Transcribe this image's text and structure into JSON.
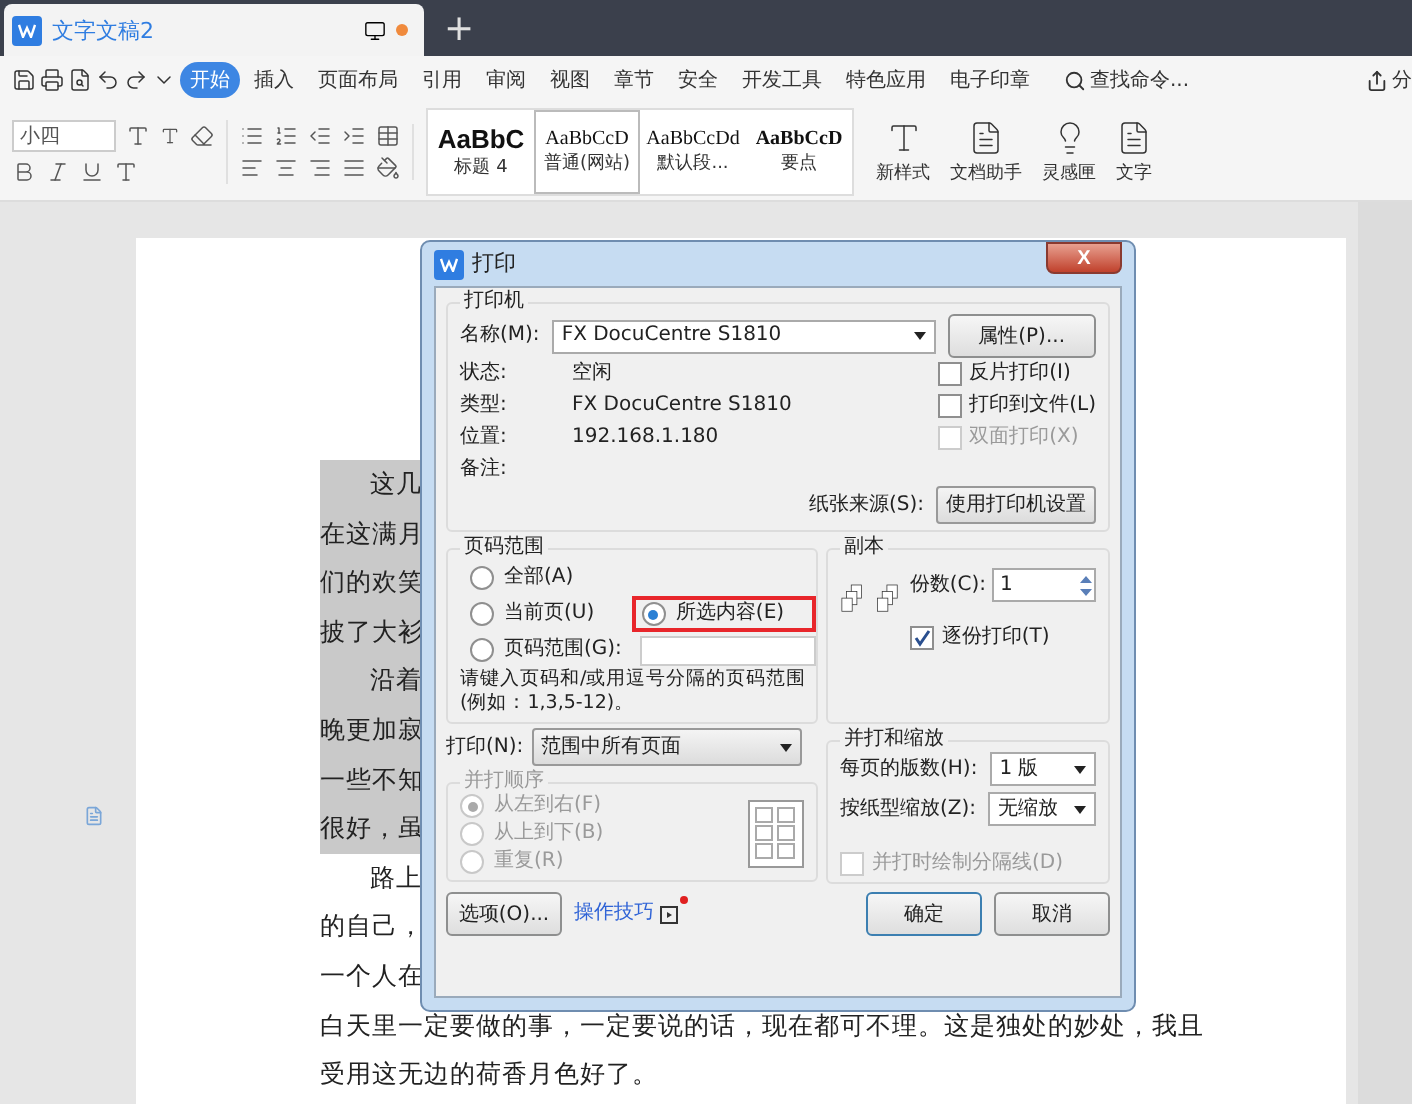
{
  "app_tab": {
    "title": "文字文稿2",
    "unsaved": true
  },
  "new_tab": "+",
  "menu": [
    {
      "label": "开始",
      "selected": true
    },
    {
      "label": "插入",
      "selected": false
    },
    {
      "label": "页面布局",
      "selected": false
    },
    {
      "label": "引用",
      "selected": false
    },
    {
      "label": "审阅",
      "selected": false
    },
    {
      "label": "视图",
      "selected": false
    },
    {
      "label": "章节",
      "selected": false
    },
    {
      "label": "安全",
      "selected": false
    },
    {
      "label": "开发工具",
      "selected": false
    },
    {
      "label": "特色应用",
      "selected": false
    },
    {
      "label": "电子印章",
      "selected": false
    }
  ],
  "search_command": "查找命令...",
  "share": "分",
  "ribbon": {
    "font_size": "小四",
    "styles": [
      {
        "sample": "AaBbC",
        "name": "标题 4",
        "kind": "heading",
        "selected": false
      },
      {
        "sample": "AaBbCcD",
        "name": "普通(网站)",
        "kind": "normal",
        "selected": true
      },
      {
        "sample": "AaBbCcDd",
        "name": "默认段...",
        "kind": "normal",
        "selected": false
      },
      {
        "sample": "AaBbCcD",
        "name": "要点",
        "kind": "bold",
        "selected": false
      }
    ],
    "new_style": "新样式",
    "tools": [
      "文档助手",
      "灵感匣",
      "文字"
    ]
  },
  "document": {
    "lines": [
      {
        "left": "这几",
        "highlighted": true,
        "indent": true
      },
      {
        "left": "在这满月",
        "highlighted": true,
        "indent": false
      },
      {
        "left": "们的欢笑",
        "highlighted": true,
        "indent": false
      },
      {
        "left": "披了大衫",
        "highlighted": true,
        "indent": false
      },
      {
        "left": "沿着",
        "highlighted": true,
        "indent": true
      },
      {
        "left": "晚更加寂",
        "highlighted": true,
        "indent": false
      },
      {
        "left": "一些不知",
        "highlighted": true,
        "indent": false
      },
      {
        "left": "很好，虽",
        "highlighted": true,
        "indent": false
      },
      {
        "left": "路上",
        "highlighted": false,
        "indent": true
      },
      {
        "left": "的自己，",
        "highlighted": false,
        "indent": false
      },
      {
        "left": "一个人在",
        "highlighted": false,
        "indent": false
      },
      {
        "left": "白天里一定要做的事，一定要说的话，现在都可不理。这是独处的妙处，我且",
        "highlighted": false,
        "indent": false
      },
      {
        "left": "受用这无边的荷香月色好了。",
        "highlighted": false,
        "indent": false
      }
    ]
  },
  "print_dialog": {
    "title": "打印",
    "close": "X",
    "printer": {
      "legend": "打印机",
      "name_label": "名称(M):",
      "name": "FX DocuCentre S1810",
      "properties_button": "属性(P)...",
      "info": [
        {
          "label": "状态:",
          "value": "空闲"
        },
        {
          "label": "类型:",
          "value": "FX DocuCentre S1810"
        },
        {
          "label": "位置:",
          "value": "192.168.1.180"
        },
        {
          "label": "备注:"
        }
      ],
      "options": [
        {
          "label": "反片打印(I)",
          "checked": false,
          "disabled": false
        },
        {
          "label": "打印到文件(L)",
          "checked": false,
          "disabled": false
        },
        {
          "label": "双面打印(X)",
          "checked": false,
          "disabled": true
        }
      ],
      "paper_source_label": "纸张来源(S):",
      "paper_source": "使用打印机设置"
    },
    "page_range": {
      "legend": "页码范围",
      "options": [
        {
          "label": "全部(A)",
          "selected": false,
          "marked": false
        },
        {
          "label": "当前页(U)",
          "selected": false,
          "marked": false
        },
        {
          "label": "所选内容(E)",
          "selected": true,
          "marked": true
        },
        {
          "label": "页码范围(G):",
          "selected": false,
          "marked": false
        }
      ],
      "hint_lines": [
        "请键入页码和/或用逗号分隔的页码范围",
        "(例如：1,3,5-12)。"
      ]
    },
    "copies": {
      "legend": "副本",
      "count_label": "份数(C):",
      "count": "1",
      "collate_label": "逐份打印(T)",
      "collate": true
    },
    "print_label": "打印(N):",
    "print_value": "范围中所有页面",
    "order": {
      "legend": "并打顺序",
      "disabled": true,
      "options": [
        {
          "label": "从左到右(F)",
          "selected": true
        },
        {
          "label": "从上到下(B)",
          "selected": false
        },
        {
          "label": "重复(R)",
          "selected": false
        }
      ]
    },
    "zoom": {
      "legend": "并打和缩放",
      "pages_label": "每页的版数(H):",
      "pages": "1 版",
      "scale_label": "按纸型缩放(Z):",
      "scale": "无缩放",
      "separator_label": "并打时绘制分隔线(D)",
      "separator_checked": false,
      "separator_disabled": true
    },
    "buttons": {
      "options": "选项(O)...",
      "tips": "操作技巧",
      "tips_new": true,
      "ok": "确定",
      "cancel": "取消"
    }
  }
}
